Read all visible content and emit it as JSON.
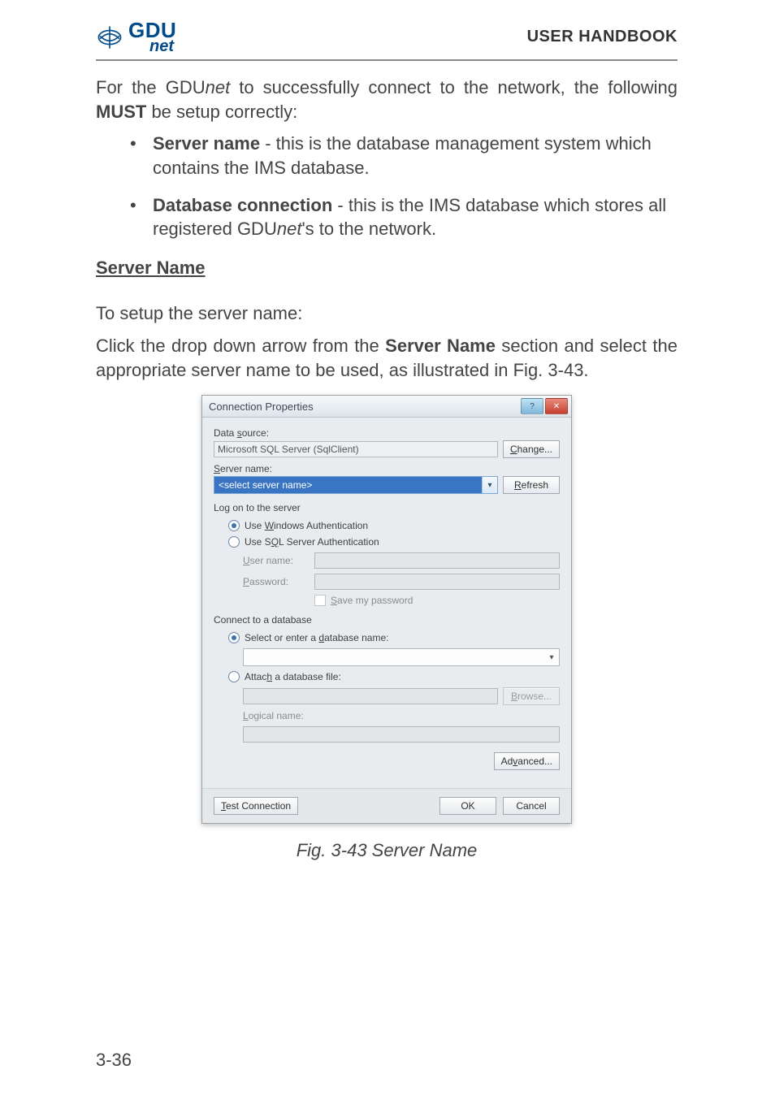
{
  "header": {
    "brand": "GDU",
    "brand_sub": "net",
    "handbook": "USER HANDBOOK"
  },
  "intro": {
    "text_before": "For the GDU",
    "text_italic": "net",
    "text_after": " to successfully connect to the network, the following ",
    "must": "MUST",
    "text_tail": " be setup correctly:"
  },
  "bullets": [
    {
      "bold": "Server name",
      "rest": " - this is the database management system which contains the IMS database."
    },
    {
      "bold": "Database connection",
      "rest_before": " - this is the IMS database which stores all registered GDU",
      "rest_italic": "net",
      "rest_after": "'s to the network."
    }
  ],
  "section_heading": "Server Name",
  "setup_line": "To setup the server name:",
  "setup_para_before": "Click the drop down arrow from the ",
  "setup_para_bold": "Server Name",
  "setup_para_after": " section and select the appropriate server name to be used, as illustrated in Fig. 3-43.",
  "dialog": {
    "title": "Connection Properties",
    "help_icon": "?",
    "close_icon": "✕",
    "data_source_label": "Data source:",
    "data_source_value": "Microsoft SQL Server (SqlClient)",
    "change_btn": "Change...",
    "server_name_label": "Server name:",
    "server_name_placeholder": "<select server name>",
    "refresh_btn": "Refresh",
    "logon_header": "Log on to the server",
    "radio_windows": "Use Windows Authentication",
    "radio_sql": "Use SQL Server Authentication",
    "username_label": "User name:",
    "password_label": "Password:",
    "save_pw": "Save my password",
    "connect_header": "Connect to a database",
    "radio_select_db": "Select or enter a database name:",
    "radio_attach": "Attach a database file:",
    "browse_btn": "Browse...",
    "logical_label": "Logical name:",
    "advanced_btn": "Advanced...",
    "test_btn": "Test Connection",
    "ok_btn": "OK",
    "cancel_btn": "Cancel"
  },
  "figure_caption": "Fig. 3-43  Server Name",
  "page_number": "3-36"
}
